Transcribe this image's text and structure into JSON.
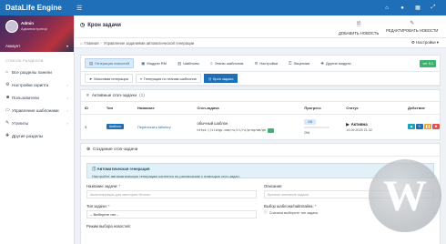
{
  "app": {
    "brand": "DataLife Engine"
  },
  "topbar": {
    "icons": [
      "home-icon",
      "user-icon",
      "grid-icon",
      "expand-icon"
    ]
  },
  "sidebar": {
    "profile_name": "Admin",
    "profile_role": "Администратор",
    "profile_user": "Аккаунт",
    "section_label": "СПИСОК РАЗДЕЛОВ",
    "items": [
      {
        "label": "Все разделы панели",
        "icon": "home-icon",
        "arrow": false
      },
      {
        "label": "Настройки скрипта",
        "icon": "gear-icon",
        "arrow": true
      },
      {
        "label": "Пользователи",
        "icon": "users-icon",
        "arrow": true
      },
      {
        "label": "Управление шаблонами",
        "icon": "layout-icon",
        "arrow": true
      },
      {
        "label": "Утилиты",
        "icon": "wrench-icon",
        "arrow": true
      },
      {
        "label": "Другие разделы",
        "icon": "puzzle-icon",
        "arrow": false
      }
    ]
  },
  "header": {
    "title": "Крон задачи",
    "add_news": "ДОБАВИТЬ НОВОСТЬ",
    "edit_news": "РЕДАКТИРОВАТЬ НОВОСТИ"
  },
  "breadcrumb": {
    "home": "Главная",
    "current": "Управление заданиями автоматической генерации",
    "settings": "Настройки"
  },
  "tabs_main": [
    {
      "label": "Генерация новостей",
      "active": true
    },
    {
      "label": "Модули RM",
      "active": false
    },
    {
      "label": "Шаблоны",
      "active": false
    },
    {
      "label": "Этапы шаблонов",
      "active": false
    },
    {
      "label": "Настройки",
      "active": false
    },
    {
      "label": "Лицензия",
      "active": false
    },
    {
      "label": "Другие модули",
      "active": false
    }
  ],
  "version": "ver 9.1",
  "tabs_sub": [
    {
      "label": "Массовая генерация",
      "active": false
    },
    {
      "label": "Генерация по этапам шаблонов",
      "active": false
    },
    {
      "label": "Крон задачи",
      "active": true
    }
  ],
  "active_jobs": {
    "title": "Активные cron-задачи",
    "count": "(1)",
    "columns": [
      "ID",
      "Тип",
      "Название",
      "Cron-задача",
      "Прогресс",
      "Статус",
      "Действие"
    ],
    "rows": [
      {
        "id": "3",
        "type": "Шаблон",
        "name": "Переписать fallstory",
        "source_title": "обычный шаблон",
        "source_url": "https://slingp.com/ru/cl/ru/program/ge",
        "progress_label": "0/8",
        "progress_percent": "0%",
        "progress_fraction": 0,
        "status": "Активна",
        "status_time": "14.09.2025 21:32"
      }
    ]
  },
  "create_form": {
    "title": "Создание cron-задачи",
    "info_title": "Автоматическая генерация",
    "info_text": "Настройте автоматическую генерацию контента по расписанию с помощью cron-задач.",
    "name_label": "Название задачи:",
    "name_placeholder": "Автогенерация для категории Фитнес",
    "desc_label": "Описание:",
    "desc_placeholder": "Краткое описание задачи",
    "type_label": "Тип задачи:",
    "type_value": "-- Выберите тип --",
    "pick_label": "Выбор шаблона/пайплайна:",
    "pick_hint": "Сначала выберите тип задачи",
    "mode_label": "Режим выбора новостей:"
  },
  "colors": {
    "primary": "#1e6fb8",
    "success": "#3cb371",
    "danger": "#d9534f",
    "info": "#17a2b8"
  }
}
